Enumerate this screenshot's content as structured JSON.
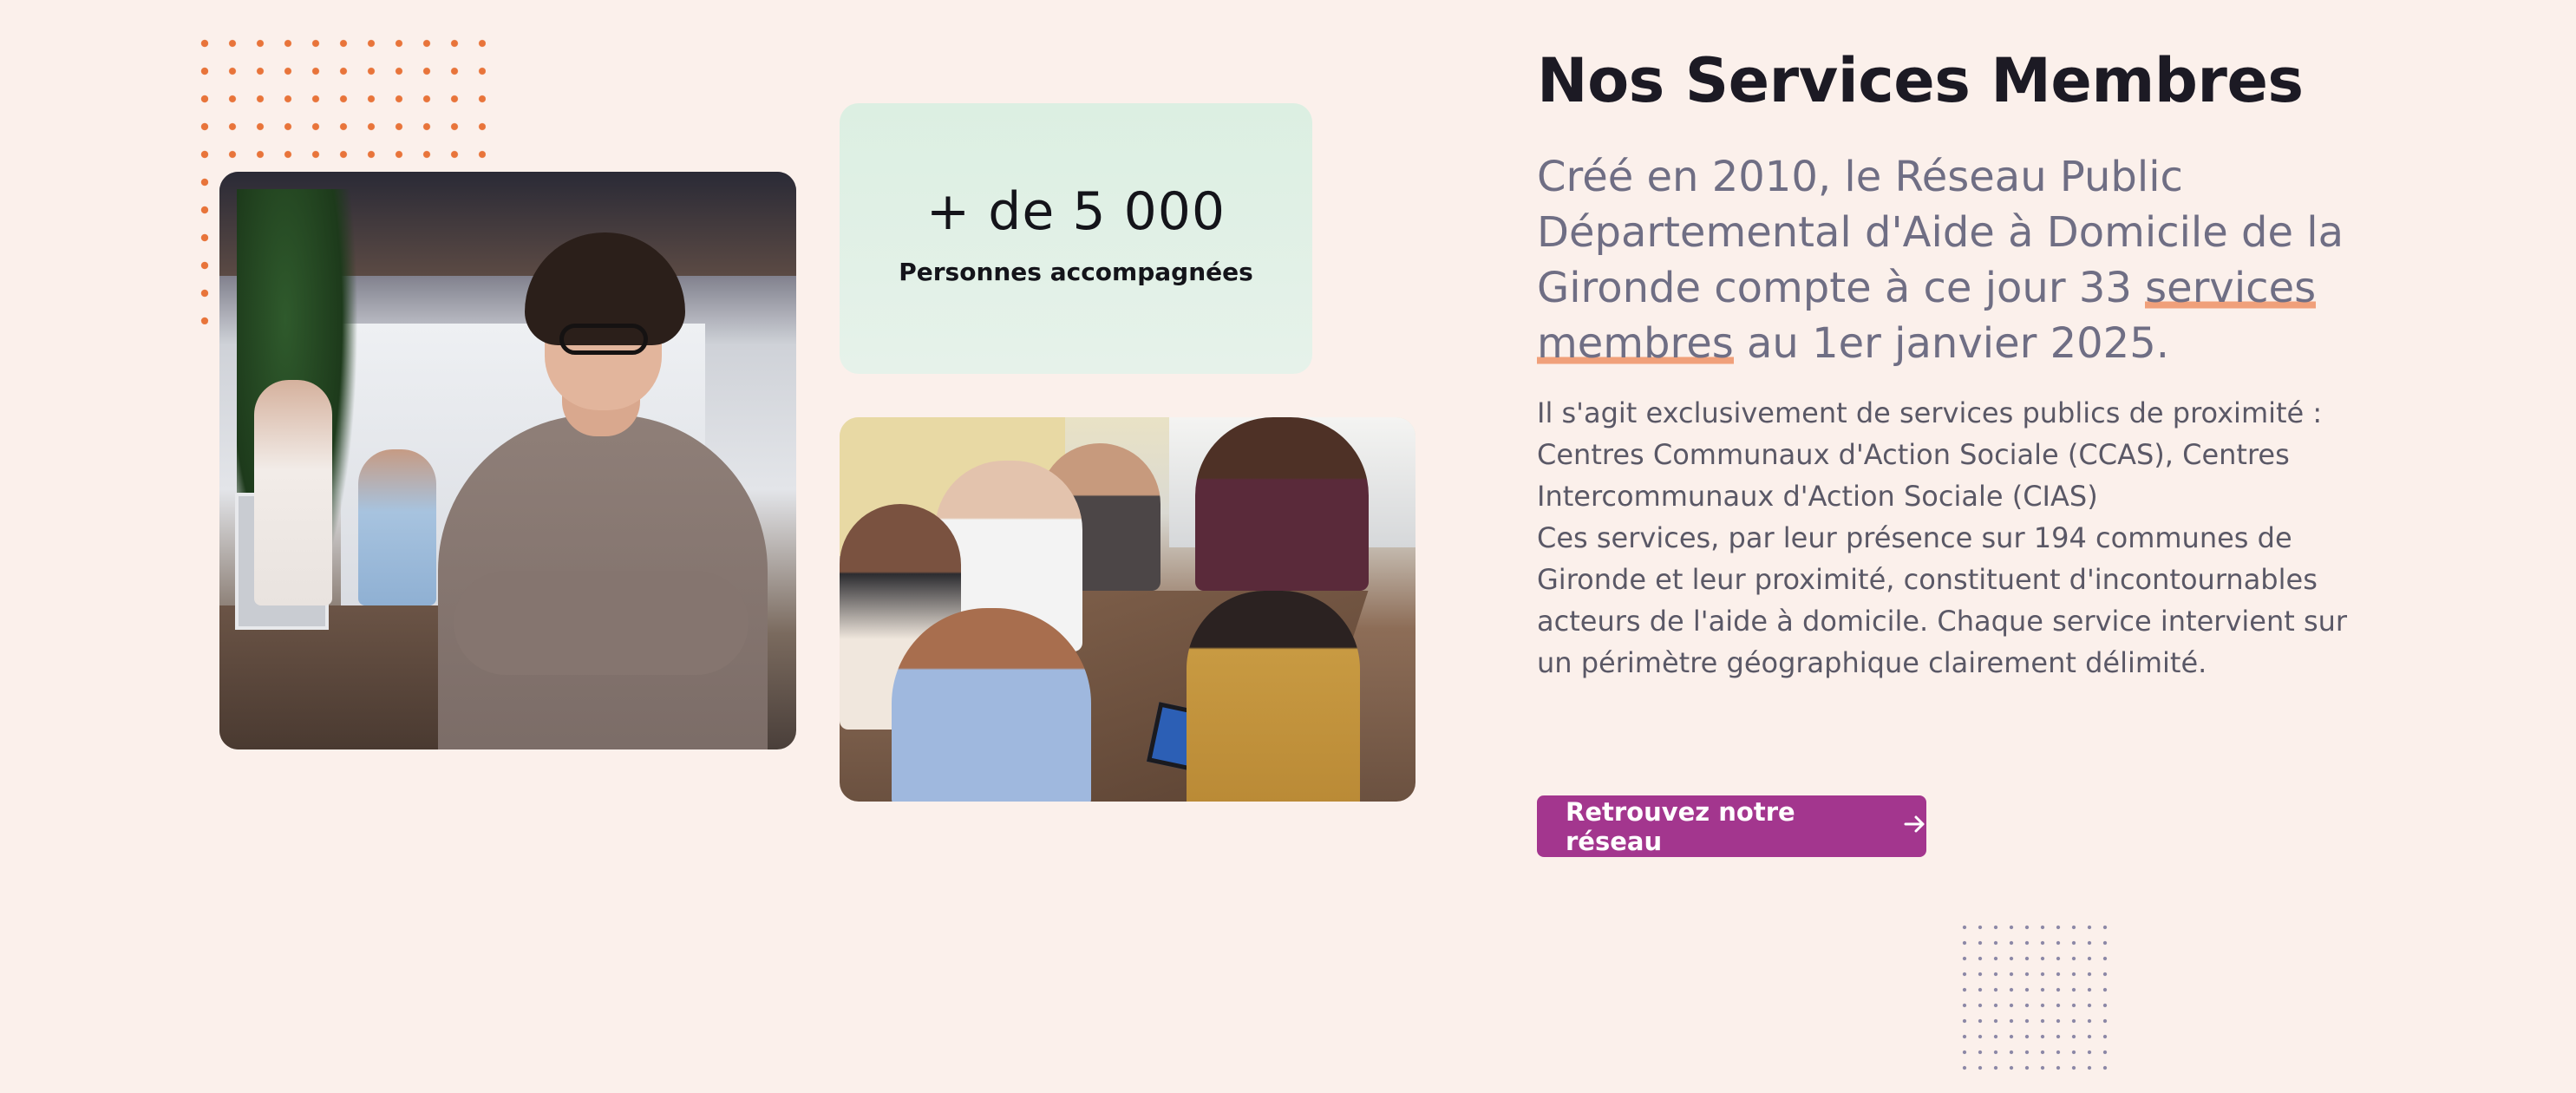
{
  "stat": {
    "number": "+ de 5 000",
    "label": "Personnes accompagnées"
  },
  "section": {
    "title": "Nos Services Membres",
    "lead_part1": "Créé en 2010, le Réseau Public Départemental d'Aide à Domicile de la Gironde compte à ce jour 33 ",
    "lead_highlight": "services membres",
    "lead_part2": " au 1er janvier 2025.",
    "description_line1": "Il s'agit exclusivement de services publics de proximité : Centres Communaux d'Action Sociale (CCAS), Centres Intercommunaux d'Action Sociale (CIAS)",
    "description_line2": "Ces services, par leur présence sur 194 communes de Gironde et leur proximité, constituent d'incontournables acteurs de l'aide à domicile. Chaque service intervient sur un périmètre géographique clairement délimité."
  },
  "cta": {
    "label": "Retrouvez notre réseau",
    "icon": "arrow-right-icon"
  },
  "colors": {
    "background": "#fbf0eb",
    "accent": "#a3368e",
    "highlight": "#f0a07a",
    "stat_card": "#dcefe2"
  }
}
